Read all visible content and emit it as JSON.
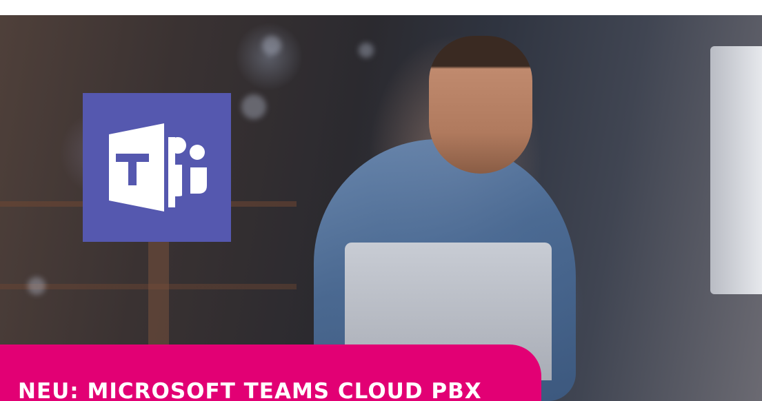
{
  "banner": {
    "title": "NEU: MICROSOFT TEAMS CLOUD PBX"
  },
  "logo": {
    "icon": "microsoft-teams-icon",
    "color": "#5558af"
  },
  "colors": {
    "banner": "#e20074",
    "background": "#ffffff"
  },
  "hero": {
    "icon": "man-on-phone-with-laptop-photo"
  }
}
